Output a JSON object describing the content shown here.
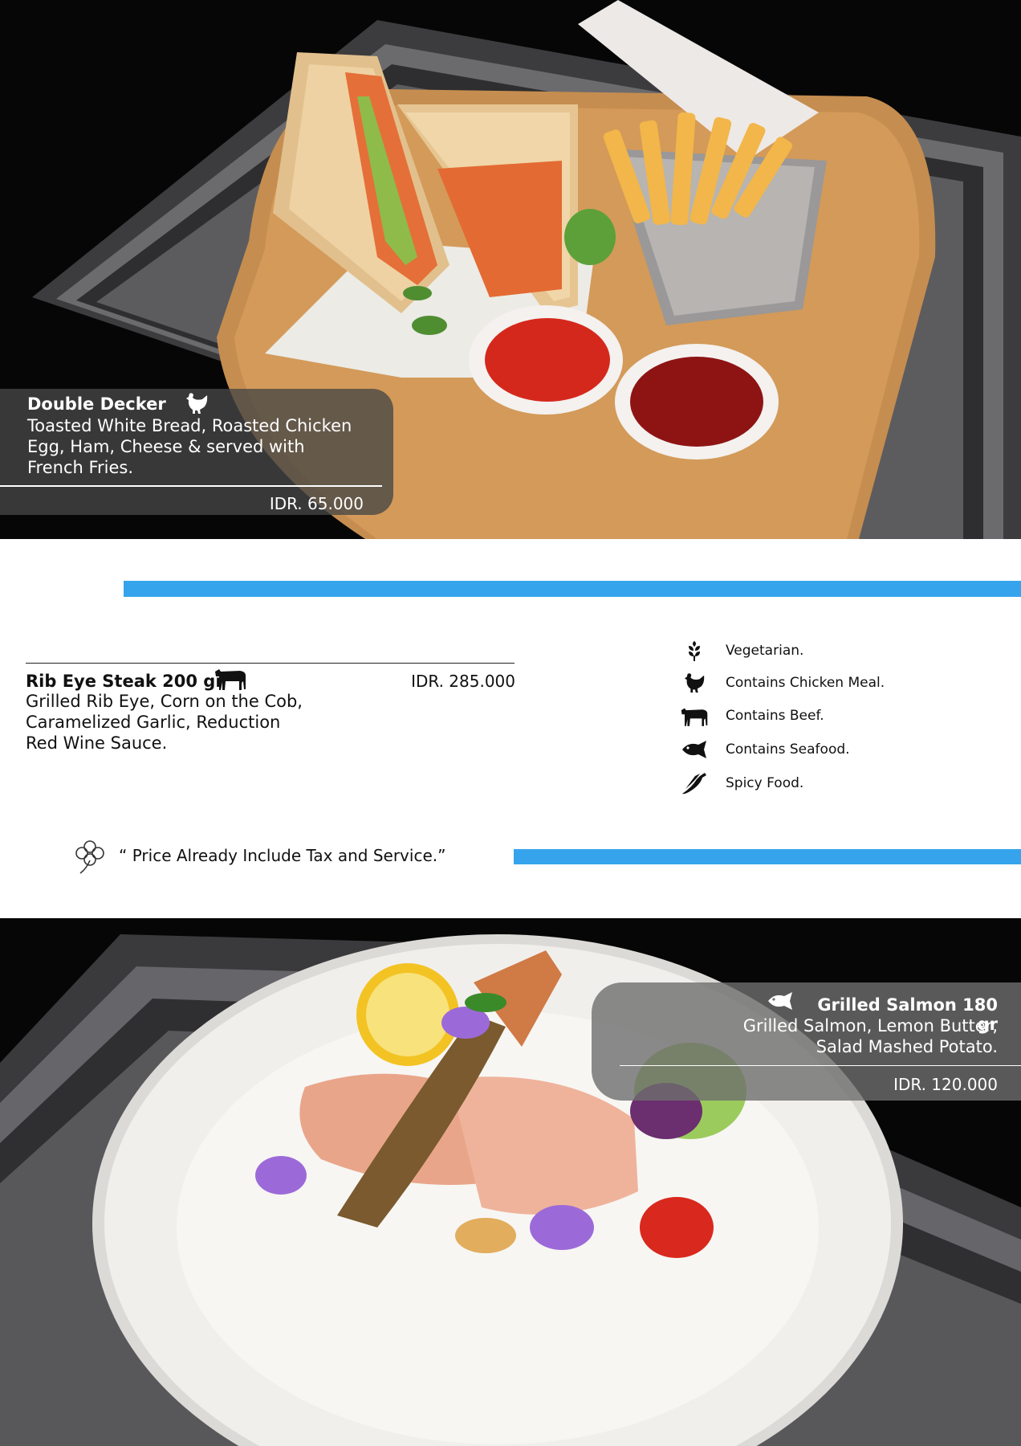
{
  "dishes": [
    {
      "title": "Double Decker",
      "description_lines": [
        "Toasted White Bread, Roasted Chicken",
        "Egg, Ham, Cheese & served with",
        "French Fries."
      ],
      "price": "IDR. 65.000",
      "icon": "chicken-icon"
    },
    {
      "title": "Rib Eye Steak 200 gr",
      "description_lines": [
        "Grilled Rib Eye, Corn on the Cob,",
        "Caramelized Garlic, Reduction",
        "Red Wine Sauce."
      ],
      "price": "IDR. 285.000",
      "icon": "beef-icon"
    },
    {
      "title": "Grilled Salmon 180 gr",
      "description_lines": [
        "Grilled Salmon, Lemon Butter,",
        "Salad Mashed Potato."
      ],
      "price": "IDR. 120.000",
      "icon": "fish-icon"
    }
  ],
  "legend": [
    {
      "icon": "vegetarian-icon",
      "label": "Vegetarian."
    },
    {
      "icon": "chicken-icon",
      "label": "Contains Chicken Meal."
    },
    {
      "icon": "beef-icon",
      "label": "Contains Beef."
    },
    {
      "icon": "fish-icon",
      "label": "Contains Seafood."
    },
    {
      "icon": "chili-icon",
      "label": "Spicy Food."
    }
  ],
  "notice": {
    "icon": "clover-icon",
    "text": "“ Price Already Include Tax and Service.”"
  },
  "colors": {
    "accent_blue": "#35a4ec",
    "photo_background": "#070707"
  }
}
